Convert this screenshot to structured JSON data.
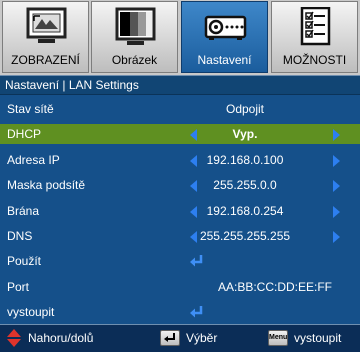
{
  "tabs": [
    {
      "label": "ZOBRAZENÍ",
      "icon": "display-icon"
    },
    {
      "label": "Obrázek",
      "icon": "picture-icon"
    },
    {
      "label": "Nastavení",
      "icon": "projector-icon",
      "active": true
    },
    {
      "label": "MOŽNOSTI",
      "icon": "options-icon"
    }
  ],
  "breadcrumb": "Nastavení | LAN Settings",
  "rows": [
    {
      "label": "Stav sítě",
      "value": "Odpojit"
    },
    {
      "label": "DHCP",
      "value": "Vyp."
    },
    {
      "label": "Adresa IP",
      "value": "192.168.0.100"
    },
    {
      "label": "Maska podsítě",
      "value": "255.255.0.0"
    },
    {
      "label": "Brána",
      "value": "192.168.0.254"
    },
    {
      "label": "DNS",
      "value": "255.255.255.255"
    },
    {
      "label": "Použít",
      "value": ""
    },
    {
      "label": "Port",
      "value": "AA:BB:CC:DD:EE:FF"
    },
    {
      "label": "vystoupit",
      "value": ""
    }
  ],
  "footer": {
    "nav_label": "Nahoru/dolů",
    "select_label": "Výběr",
    "menu_key": "Menu",
    "exit_label": "vystoupit"
  },
  "colors": {
    "background": "#15508a",
    "selected_row": "#5f9021",
    "arrow": "#2d7ff0",
    "active_tab": "#2d70b2"
  }
}
